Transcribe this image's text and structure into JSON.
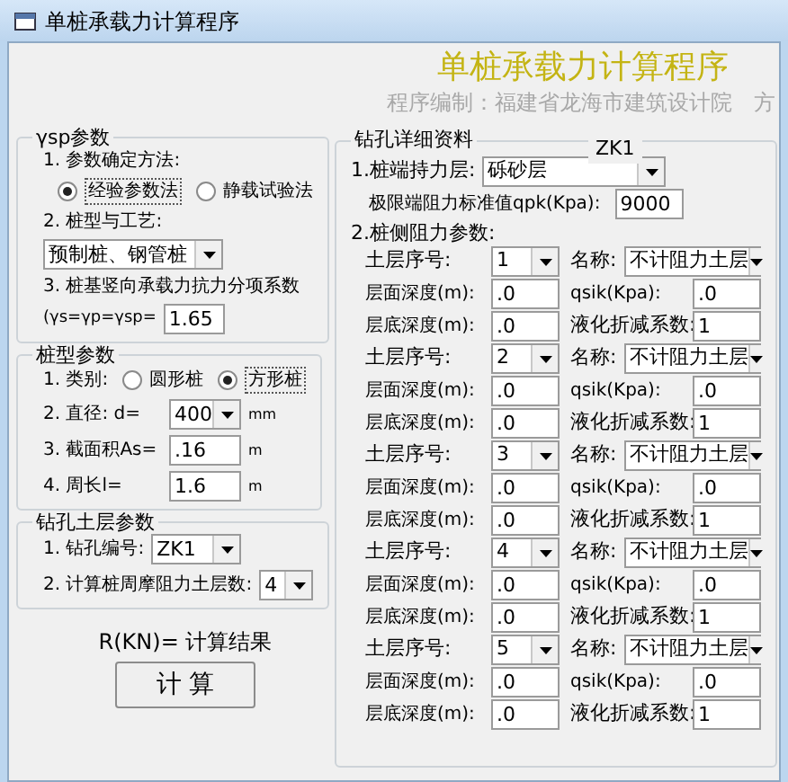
{
  "window": {
    "title": "单桩承载力计算程序"
  },
  "header": {
    "title": "单桩承载力计算程序",
    "credit": "程序编制：福建省龙海市建筑设计院　方"
  },
  "gamma_group": {
    "title": "γsp参数",
    "method_label": "1. 参数确定方法:",
    "methods": [
      {
        "label": "经验参数法",
        "selected": true
      },
      {
        "label": "静载试验法",
        "selected": false
      }
    ],
    "pile_type_label": "2. 桩型与工艺:",
    "pile_type": "预制桩、钢管桩",
    "factor_label": "3. 桩基竖向承载力抗力分项系数",
    "factor_formula": "(γs=γp=γsp=",
    "factor_value": "1.65"
  },
  "pile_group": {
    "title": "桩型参数",
    "shape_label": "1. 类别:",
    "shapes": [
      {
        "label": "圆形桩",
        "selected": false
      },
      {
        "label": "方形桩",
        "selected": true
      }
    ],
    "diameter_label": "2. 直径: d=",
    "diameter": "400",
    "diameter_unit": "mm",
    "area_label": "3. 截面积As=",
    "area": ".16",
    "area_unit": "m",
    "perimeter_label": "4. 周长l=",
    "perimeter": "1.6",
    "perimeter_unit": "m"
  },
  "borehole_group": {
    "title": "钻孔土层参数",
    "hole_label": "1. 钻孔编号:",
    "hole": "ZK1",
    "count_label": "2. 计算桩周摩阻力土层数:",
    "count": "4"
  },
  "result": {
    "label": "R(KN)= 计算结果",
    "button": "计 算"
  },
  "detail": {
    "title": "钻孔详细资料",
    "hole": "ZK1",
    "bearing_label": "1.桩端持力层:",
    "bearing": "砾砂层",
    "qpk_label": "极限端阻力标准值qpk(Kpa):",
    "qpk": "9000",
    "side_label": "2.桩侧阻力参数:",
    "layers": [
      {
        "index_label": "土层序号:",
        "index": "1",
        "name_label": "名称:",
        "name": "不计阻力土层",
        "top_label": "层面深度(m):",
        "top": ".0",
        "qsik_label": "qsik(Kpa):",
        "qsik": ".0",
        "bottom_label": "层底深度(m):",
        "bottom": ".0",
        "factor_label": "液化折减系数:",
        "factor": "1"
      },
      {
        "index_label": "土层序号:",
        "index": "2",
        "name_label": "名称:",
        "name": "不计阻力土层",
        "top_label": "层面深度(m):",
        "top": ".0",
        "qsik_label": "qsik(Kpa):",
        "qsik": ".0",
        "bottom_label": "层底深度(m):",
        "bottom": ".0",
        "factor_label": "液化折减系数:",
        "factor": "1"
      },
      {
        "index_label": "土层序号:",
        "index": "3",
        "name_label": "名称:",
        "name": "不计阻力土层",
        "top_label": "层面深度(m):",
        "top": ".0",
        "qsik_label": "qsik(Kpa):",
        "qsik": ".0",
        "bottom_label": "层底深度(m):",
        "bottom": ".0",
        "factor_label": "液化折减系数:",
        "factor": "1"
      },
      {
        "index_label": "土层序号:",
        "index": "4",
        "name_label": "名称:",
        "name": "不计阻力土层",
        "top_label": "层面深度(m):",
        "top": ".0",
        "qsik_label": "qsik(Kpa):",
        "qsik": ".0",
        "bottom_label": "层底深度(m):",
        "bottom": ".0",
        "factor_label": "液化折减系数:",
        "factor": "1"
      },
      {
        "index_label": "土层序号:",
        "index": "5",
        "name_label": "名称:",
        "name": "不计阻力土层",
        "top_label": "层面深度(m):",
        "top": ".0",
        "qsik_label": "qsik(Kpa):",
        "qsik": ".0",
        "bottom_label": "层底深度(m):",
        "bottom": ".0",
        "factor_label": "液化折减系数:",
        "factor": "1"
      }
    ]
  }
}
